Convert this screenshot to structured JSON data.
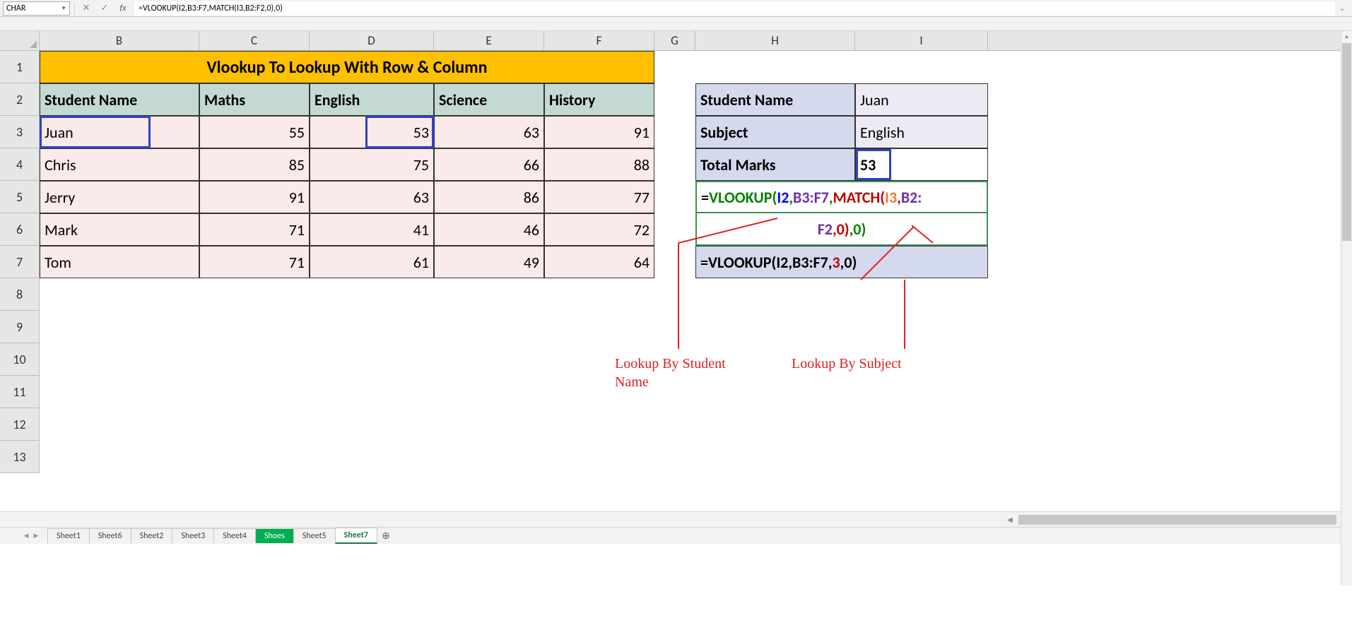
{
  "name_box": "CHAR",
  "formula_bar": "=VLOOKUP(I2,B3:F7,MATCH(I3,B2:F2,0),0)",
  "columns": [
    "B",
    "C",
    "D",
    "E",
    "F",
    "G",
    "H",
    "I"
  ],
  "rows": [
    "1",
    "2",
    "3",
    "4",
    "5",
    "6",
    "7",
    "8",
    "9",
    "10",
    "11",
    "12",
    "13"
  ],
  "title": "Vlookup To Lookup With Row & Column",
  "headers": [
    "Student Name",
    "Maths",
    "English",
    "Science",
    "History"
  ],
  "data": [
    {
      "name": "Juan",
      "m": "55",
      "e": "53",
      "s": "63",
      "h": "91"
    },
    {
      "name": "Chris",
      "m": "85",
      "e": "75",
      "s": "66",
      "h": "88"
    },
    {
      "name": "Jerry",
      "m": "91",
      "e": "63",
      "s": "86",
      "h": "77"
    },
    {
      "name": "Mark",
      "m": "71",
      "e": "41",
      "s": "46",
      "h": "72"
    },
    {
      "name": "Tom",
      "m": "71",
      "e": "61",
      "s": "49",
      "h": "64"
    }
  ],
  "side": {
    "labels": [
      "Student Name",
      "Subject",
      "Total Marks"
    ],
    "values": [
      "Juan",
      "English",
      "53"
    ]
  },
  "formula1": {
    "eq": "=",
    "fn": "VLOOKUP(",
    "a1": "I2",
    ",": ",",
    "a2": "B3:F7",
    "fn2": "MATCH(",
    "a3": "I3",
    "a4": "B2:",
    "a5": "F2",
    "z1": ",0)",
    "z2": ",0)"
  },
  "formula2_pre": "=VLOOKUP(I2,B3:F7,",
  "formula2_mid": "3",
  "formula2_post": ",0)",
  "annotations": {
    "left": "Lookup By Student",
    "left2": "Name",
    "right": "Lookup By Subject"
  },
  "tabs": [
    "Sheet1",
    "Sheet6",
    "Sheet2",
    "Sheet3",
    "Sheet4",
    "Shoes",
    "Sheet5",
    "Sheet7"
  ]
}
